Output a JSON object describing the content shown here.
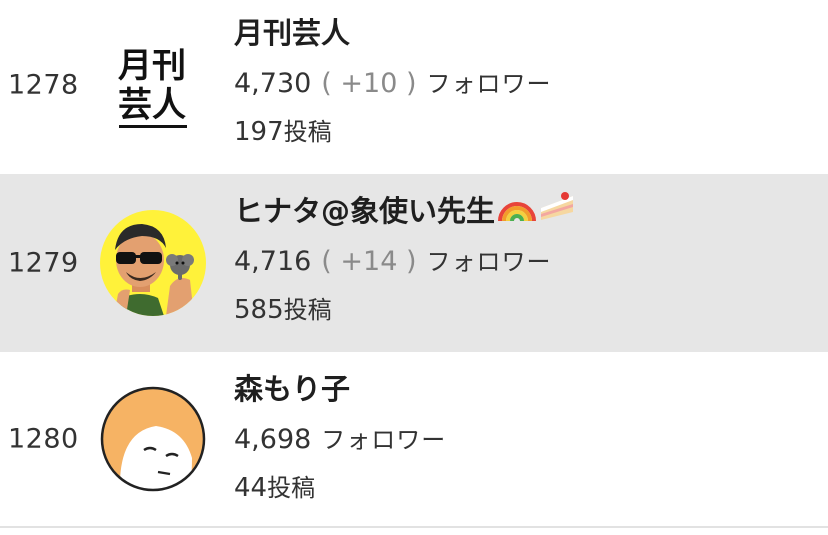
{
  "ranking": {
    "items": [
      {
        "rank": "1278",
        "name": "月刊芸人",
        "avatar_text_line1": "月刊",
        "avatar_text_line2": "芸人",
        "followers": "4,730",
        "delta": "( +10 )",
        "followers_label": "フォロワー",
        "posts": "197",
        "posts_label": "投稿"
      },
      {
        "rank": "1279",
        "name": "ヒナタ@象使い先生",
        "emojis": [
          "rainbow-icon",
          "cake-icon"
        ],
        "followers": "4,716",
        "delta": "( +14 )",
        "followers_label": "フォロワー",
        "posts": "585",
        "posts_label": "投稿"
      },
      {
        "rank": "1280",
        "name": "森もり子",
        "followers": "4,698",
        "followers_label": "フォロワー",
        "posts": "44",
        "posts_label": "投稿"
      }
    ]
  },
  "colors": {
    "highlight_row": "#e6e6e6",
    "delta_gray": "#8a8a8a",
    "avatar_yellow": "#fff23a",
    "avatar_orange": "#f6b364"
  }
}
